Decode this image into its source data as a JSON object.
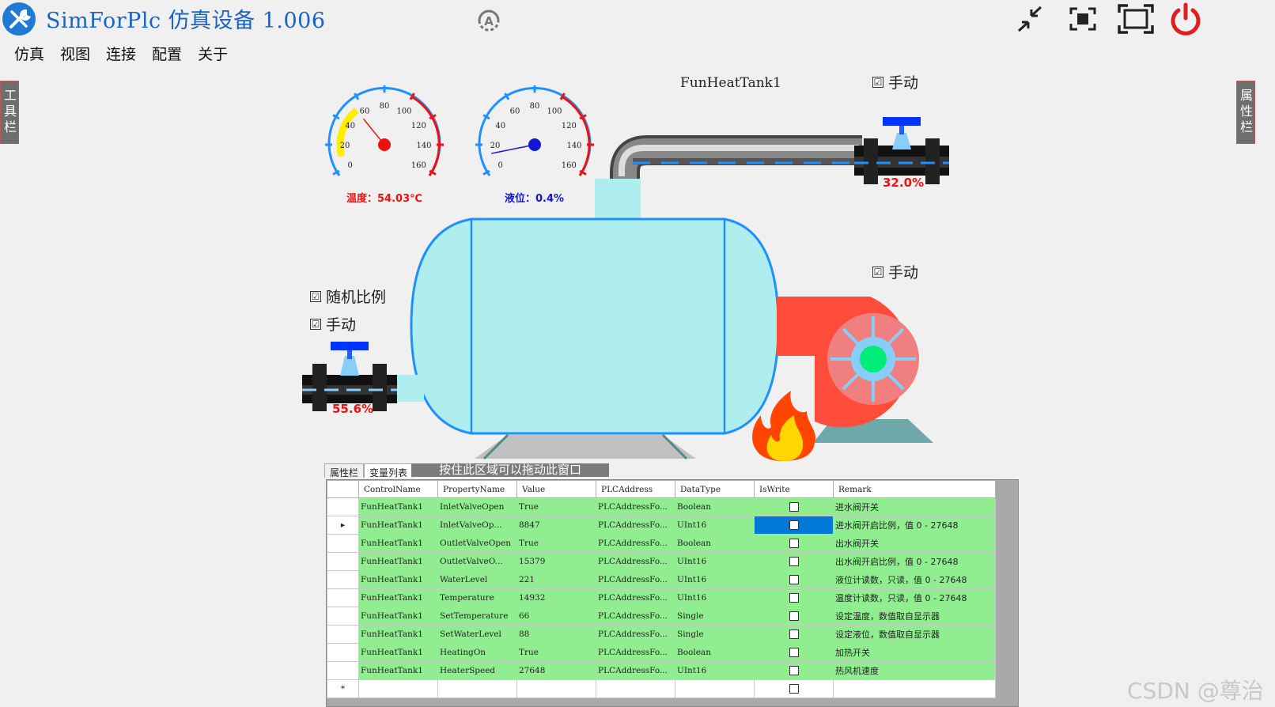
{
  "app": {
    "title": "SimForPlc 仿真设备 1.006"
  },
  "menu": {
    "items": [
      "仿真",
      "视图",
      "连接",
      "配置",
      "关于"
    ]
  },
  "side_tabs": {
    "left": "工具栏",
    "right": "属性栏"
  },
  "device": {
    "name": "FunHeatTank1"
  },
  "gauges": {
    "temperature": {
      "readout": "温度：54.03℃",
      "value": 54.03,
      "ticks": [
        "0",
        "20",
        "40",
        "60",
        "80",
        "100",
        "120",
        "140",
        "160"
      ],
      "color": "#ee1111"
    },
    "level": {
      "readout": "液位：0.4%",
      "value": 0.4,
      "ticks": [
        "0",
        "20",
        "40",
        "60",
        "80",
        "100",
        "120",
        "140",
        "160"
      ],
      "color": "#1515d8"
    }
  },
  "checkboxes": {
    "outlet_manual": "手动",
    "fan_manual": "手动",
    "inlet_random": "随机比例",
    "inlet_manual": "手动",
    "mark": "☑"
  },
  "valves": {
    "outlet_percent": "32.0%",
    "inlet_percent": "55.6%"
  },
  "panel": {
    "tabs": [
      "属性栏",
      "变量列表"
    ],
    "drag_hint": "按住此区域可以拖动此窗口"
  },
  "grid": {
    "columns": [
      "ControlName",
      "PropertyName",
      "Value",
      "PLCAddress",
      "DataType",
      "IsWrite",
      "Remark"
    ],
    "rows": [
      [
        "FunHeatTank1",
        "InletValveOpen",
        "True",
        "PLCAddressFo...",
        "Boolean",
        "进水阀开关"
      ],
      [
        "FunHeatTank1",
        "InletValveOp...",
        "8847",
        "PLCAddressFo...",
        "UInt16",
        "进水阀开启比例，值 0 - 27648"
      ],
      [
        "FunHeatTank1",
        "OutletValveOpen",
        "True",
        "PLCAddressFo...",
        "Boolean",
        "出水阀开关"
      ],
      [
        "FunHeatTank1",
        "OutletValveO...",
        "15379",
        "PLCAddressFo...",
        "UInt16",
        "出水阀开启比例，值 0 - 27648"
      ],
      [
        "FunHeatTank1",
        "WaterLevel",
        "221",
        "PLCAddressFo...",
        "UInt16",
        "液位计读数，只读，值 0 - 27648"
      ],
      [
        "FunHeatTank1",
        "Temperature",
        "14932",
        "PLCAddressFo...",
        "UInt16",
        "温度计读数，只读，值 0 - 27648"
      ],
      [
        "FunHeatTank1",
        "SetTemperature",
        "66",
        "PLCAddressFo...",
        "Single",
        "设定温度，数值取自显示器"
      ],
      [
        "FunHeatTank1",
        "SetWaterLevel",
        "88",
        "PLCAddressFo...",
        "Single",
        "设定液位，数值取自显示器"
      ],
      [
        "FunHeatTank1",
        "HeatingOn",
        "True",
        "PLCAddressFo...",
        "Boolean",
        "加热开关"
      ],
      [
        "FunHeatTank1",
        "HeaterSpeed",
        "27648",
        "PLCAddressFo...",
        "UInt16",
        "热风机速度"
      ]
    ],
    "selected_row_marker": "▸",
    "new_row_marker": "*"
  },
  "watermark": "CSDN @尊治",
  "colors": {
    "accent": "#1a63c7",
    "tank_fill": "#aeeeee",
    "tank_stroke": "#1e90ff",
    "grid_row": "#90ee90",
    "selection": "#0078d7",
    "power": "#e02020",
    "fan_body": "#ff4c3b"
  },
  "icons": [
    "wrench-screwdriver-icon",
    "auto-mode-icon",
    "minimize-icon",
    "restore-icon",
    "fullscreen-icon",
    "power-icon"
  ]
}
